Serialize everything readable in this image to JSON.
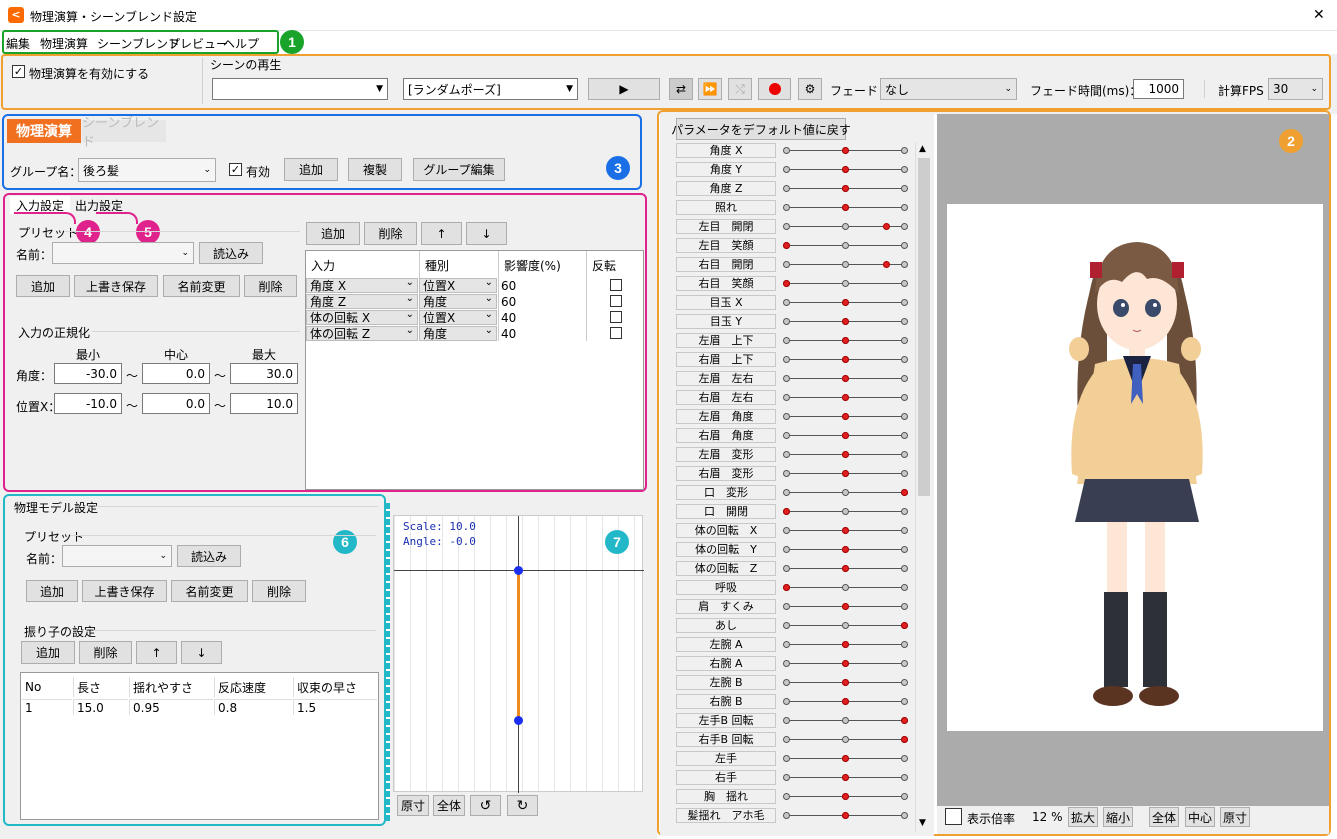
{
  "window": {
    "title": "物理演算・シーンブレンド設定",
    "close_glyph": "✕"
  },
  "menu": [
    "編集",
    "物理演算",
    "シーンブレンド",
    "プレビュー",
    "ヘルプ"
  ],
  "badges": [
    "1",
    "2",
    "3",
    "4",
    "5",
    "6",
    "7"
  ],
  "toolbar": {
    "physics_enable": "物理演算を有効にする",
    "scene_play": "シーンの再生",
    "scene_combo": "",
    "pose_combo": "[ランダムポーズ]",
    "fade_label": "フェード：",
    "fade_value": "なし",
    "fade_time_label": "フェード時間(ms)：",
    "fade_time_value": "1000",
    "fps_label": "計算FPS",
    "fps_value": "30"
  },
  "tabs": {
    "physics": "物理演算",
    "scene_blend": "シーンブレンド"
  },
  "group": {
    "label": "グループ名：",
    "value": "後ろ髪",
    "enabled": "有効",
    "add": "追加",
    "copy": "複製",
    "edit": "グループ編集"
  },
  "io_tabs": {
    "input": "入力設定",
    "output": "出力設定"
  },
  "preset": {
    "title": "プリセット",
    "name_label": "名前：",
    "load": "読込み",
    "add": "追加",
    "overwrite": "上書き保存",
    "rename": "名前変更",
    "delete": "削除"
  },
  "normalize": {
    "title": "入力の正規化",
    "min": "最小",
    "center": "中心",
    "max": "最大",
    "tilde": "～",
    "angle_label": "角度：",
    "angle_min": "-30.0",
    "angle_center": "0.0",
    "angle_max": "30.0",
    "pos_label": "位置X：",
    "pos_min": "-10.0",
    "pos_center": "0.0",
    "pos_max": "10.0"
  },
  "input_table": {
    "add": "追加",
    "delete": "削除",
    "up": "↑",
    "down": "↓",
    "headers": [
      "入力",
      "種別",
      "影響度(%)",
      "反転"
    ],
    "rows": [
      {
        "input": "角度 X",
        "type": "位置X",
        "influence": "60"
      },
      {
        "input": "角度 Z",
        "type": "角度",
        "influence": "60"
      },
      {
        "input": "体の回転 X",
        "type": "位置X",
        "influence": "40"
      },
      {
        "input": "体の回転 Z",
        "type": "角度",
        "influence": "40"
      }
    ]
  },
  "model": {
    "title": "物理モデル設定",
    "pendulum_title": "振り子の設定",
    "headers": [
      "No",
      "長さ",
      "揺れやすさ",
      "反応速度",
      "収束の早さ"
    ],
    "rows": [
      [
        "1",
        "15.0",
        "0.95",
        "0.8",
        "1.5"
      ]
    ],
    "scale": "Scale: 10.0",
    "angle": "Angle: -0.0",
    "view_buttons": [
      "原寸",
      "全体",
      "↺",
      "↻"
    ]
  },
  "params": {
    "reset": "パラメータをデフォルト値に戻す",
    "items": [
      {
        "name": "角度 X",
        "v": 0.5
      },
      {
        "name": "角度 Y",
        "v": 0.5
      },
      {
        "name": "角度 Z",
        "v": 0.5
      },
      {
        "name": "照れ",
        "v": 0.5
      },
      {
        "name": "左目　開閉",
        "v": 0.85
      },
      {
        "name": "左目　笑顔",
        "v": 0
      },
      {
        "name": "右目　開閉",
        "v": 0.85
      },
      {
        "name": "右目　笑顔",
        "v": 0
      },
      {
        "name": "目玉 X",
        "v": 0.5
      },
      {
        "name": "目玉 Y",
        "v": 0.5
      },
      {
        "name": "左眉　上下",
        "v": 0.5
      },
      {
        "name": "右眉　上下",
        "v": 0.5
      },
      {
        "name": "左眉　左右",
        "v": 0.5
      },
      {
        "name": "右眉　左右",
        "v": 0.5
      },
      {
        "name": "左眉　角度",
        "v": 0.5
      },
      {
        "name": "右眉　角度",
        "v": 0.5
      },
      {
        "name": "左眉　変形",
        "v": 0.5
      },
      {
        "name": "右眉　変形",
        "v": 0.5
      },
      {
        "name": "口　変形",
        "v": 1
      },
      {
        "name": "口　開閉",
        "v": 0
      },
      {
        "name": "体の回転　X",
        "v": 0.5
      },
      {
        "name": "体の回転　Y",
        "v": 0.5
      },
      {
        "name": "体の回転　Z",
        "v": 0.5
      },
      {
        "name": "呼吸",
        "v": 0
      },
      {
        "name": "肩　すくみ",
        "v": 0.5
      },
      {
        "name": "あし",
        "v": 1
      },
      {
        "name": "左腕 A",
        "v": 0.5
      },
      {
        "name": "右腕 A",
        "v": 0.5
      },
      {
        "name": "左腕 B",
        "v": 0.5
      },
      {
        "name": "右腕 B",
        "v": 0.5
      },
      {
        "name": "左手B 回転",
        "v": 1
      },
      {
        "name": "右手B 回転",
        "v": 1
      },
      {
        "name": "左手",
        "v": 0.5
      },
      {
        "name": "右手",
        "v": 0.5
      },
      {
        "name": "胸　揺れ",
        "v": 0.5
      },
      {
        "name": "髪揺れ　アホ毛",
        "v": 0.5
      }
    ]
  },
  "preview": {
    "zoom_label": "表示倍率",
    "zoom_value": "12 %",
    "zoom_in": "拡大",
    "zoom_out": "縮小",
    "all": "全体",
    "center": "中心",
    "actual": "原寸"
  },
  "colors": {
    "accent_orange": "#ff6a00",
    "green": "#1aa32a",
    "blue": "#1a6fe6",
    "magenta": "#e0228c",
    "teal": "#22b8c8",
    "frame_orange": "#f0a030"
  }
}
